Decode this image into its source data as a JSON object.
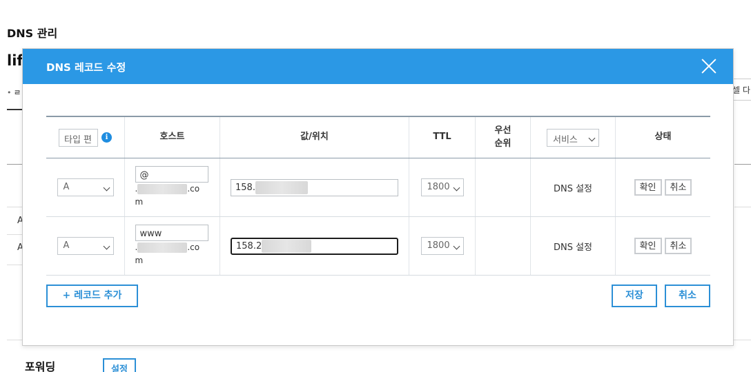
{
  "background": {
    "page_title": "DNS 관리",
    "domain_partial": "lif",
    "tab_partial": "ㄹ",
    "excel_button_partial": "셀 다",
    "row_a1": "A",
    "row_a2": "A",
    "forwarding_title": "포워딩",
    "forwarding_setting_button": "설정"
  },
  "modal": {
    "title": "DNS 레코드 수정",
    "table": {
      "headers": {
        "type_select": "타입 편",
        "host": "호스트",
        "value": "값/위치",
        "ttl": "TTL",
        "priority_line1": "우선",
        "priority_line2": "순위",
        "service_select": "서비스",
        "status": "상태"
      },
      "rows": [
        {
          "type": "A",
          "host": "@",
          "host_suffix_dot": ".",
          "host_suffix_co": ".co",
          "host_suffix_m": "m",
          "value": "158.",
          "ttl": "1800",
          "priority": "",
          "service": "DNS 설정",
          "confirm": "확인",
          "cancel": "취소"
        },
        {
          "type": "A",
          "host": "www",
          "host_suffix_dot": ".",
          "host_suffix_co": ".co",
          "host_suffix_m": "m",
          "value": "158.2",
          "ttl": "1800",
          "priority": "",
          "service": "DNS 설정",
          "confirm": "확인",
          "cancel": "취소"
        }
      ]
    },
    "add_record_button": "+ 레코드 추가",
    "save_button": "저장",
    "cancel_button": "취소"
  },
  "colors": {
    "header_blue": "#2b98e5",
    "accent_blue": "#2b8fd6",
    "info_icon_blue": "#1f8de0"
  }
}
